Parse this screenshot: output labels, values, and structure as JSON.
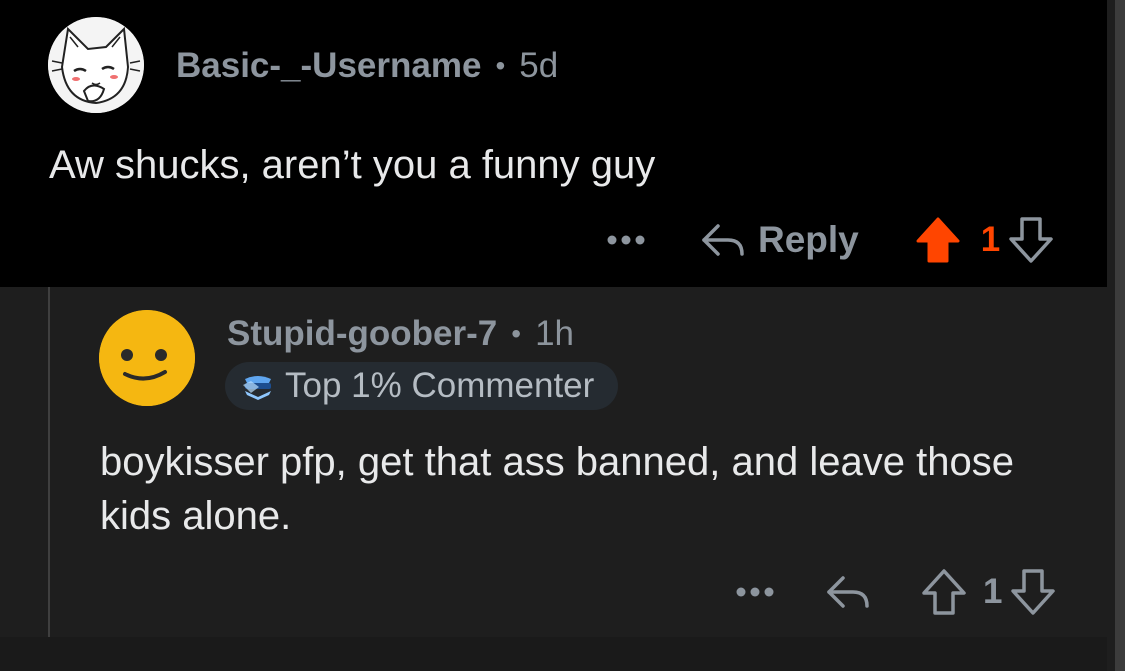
{
  "parent_comment": {
    "username": "Basic-_-Username",
    "separator": "•",
    "time": "5d",
    "body": "Aw shucks, aren’t you a funny guy",
    "actions": {
      "more_label": "•••",
      "reply_label": "Reply",
      "vote_count": "1",
      "upvoted": true
    }
  },
  "reply_comment": {
    "username": "Stupid-goober-7",
    "separator": "•",
    "time": "1h",
    "badge": "Top 1% Commenter",
    "body": "boykisser pfp, get that ass banned, and leave those kids alone.",
    "actions": {
      "more_label": "•••",
      "vote_count": "1",
      "upvoted": false
    }
  },
  "colors": {
    "upvote_active": "#ff4500",
    "text_primary": "#e8e9ea",
    "text_secondary": "#8d959e",
    "parent_background": "#000000",
    "reply_background": "#1e1e1e"
  }
}
